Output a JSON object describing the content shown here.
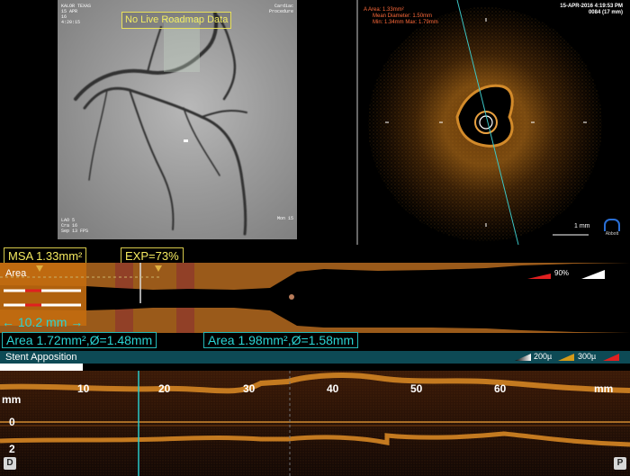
{
  "angio": {
    "overlay_title": "No Live Roadmap Data",
    "tl_line1": "KALOR TEXAS",
    "tl_line2": "15 APR",
    "tl_line3": "16",
    "tl_line4": "4:20:15",
    "tr_line1": "Cardiac",
    "tr_line2": "Procedure",
    "bl_line1": "LAO 5",
    "bl_line2": "Cra 16",
    "bl_line3": "Sep 13 FPS",
    "br_line1": "Mon 15"
  },
  "oct": {
    "area_line": "A Area: 1.33mm²",
    "mean_diam_line": "Mean Diameter: 1.50mm",
    "minmax_line": "Min: 1.34mm  Max: 1.79mm",
    "date_line": "15-APR-2016 4:19:53 PM",
    "frame_line": "0084 (17 mm)",
    "scale_label": "1 mm",
    "brand": "Abbott"
  },
  "profile": {
    "msa": "MSA 1.33mm²",
    "exp": "EXP=73%",
    "area_tag": "Area",
    "percent": "90%",
    "length": "← 10.2 mm →",
    "ref_left": "Area 1.72mm²,Ø=1.48mm",
    "ref_right": "Area 1.98mm²,Ø=1.58mm"
  },
  "stent": {
    "label": "Stent Apposition",
    "legend_200": "200µ",
    "legend_300": "300µ"
  },
  "lview": {
    "unit": "mm",
    "unit_right": "mm",
    "ticks": [
      "10",
      "20",
      "30",
      "40",
      "50",
      "60"
    ],
    "y_zero": "0",
    "y_two": "2",
    "dist": "D",
    "prox": "P"
  },
  "colors": {
    "accent_yellow": "#f5ea60",
    "accent_cyan": "#2ad4d4",
    "lumen_orange": "#b8681c"
  }
}
